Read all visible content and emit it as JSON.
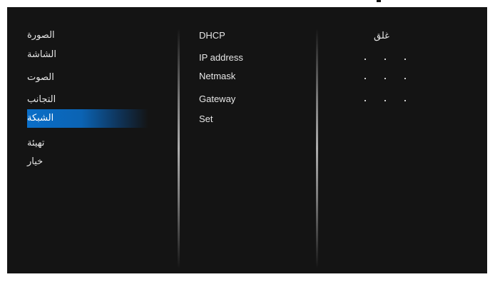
{
  "menu": {
    "items": [
      {
        "label": "الصورة",
        "selected": false
      },
      {
        "label": "الشاشة",
        "selected": false
      },
      {
        "label": "الصوت",
        "selected": false
      },
      {
        "label": "التجانب",
        "selected": false
      },
      {
        "label": "الشبكة",
        "selected": true
      },
      {
        "label": "تهيئة",
        "selected": false
      },
      {
        "label": "خيار",
        "selected": false
      }
    ],
    "accent_color": "#0a6ec8"
  },
  "network": {
    "items": [
      {
        "label": "DHCP"
      },
      {
        "label": "IP address"
      },
      {
        "label": "Netmask"
      },
      {
        "label": "Gateway"
      },
      {
        "label": "Set"
      }
    ],
    "dhcp_value": "غلق",
    "address_separator": "."
  },
  "colors": {
    "screen_background": "#141414",
    "text": "#e6e6e6"
  }
}
